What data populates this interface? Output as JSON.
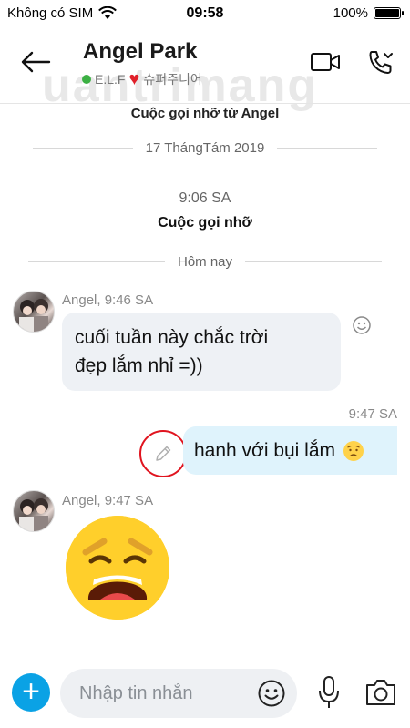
{
  "status": {
    "carrier": "Không có SIM",
    "time": "09:58",
    "battery": "100%"
  },
  "header": {
    "name": "Angel Park",
    "status_label": "E.L.F",
    "mood": "슈퍼주니어",
    "pinned": "Cuộc gọi nhỡ từ Angel"
  },
  "messages": {
    "date1": "17 ThángTám 2019",
    "call_time": "9:06 SA",
    "call_label": "Cuộc gọi nhỡ",
    "today": "Hôm nay",
    "msg1": {
      "sender": "Angel, 9:46 SA",
      "line1": "cuối tuần này chắc trời",
      "line2": "đẹp lắm nhỉ =))"
    },
    "msg2": {
      "time": "9:47 SA",
      "text": "hanh với bụi lắm"
    },
    "msg3": {
      "sender": "Angel, 9:47 SA"
    }
  },
  "composer": {
    "placeholder": "Nhập tin nhắn"
  },
  "watermark": "uantrimang",
  "colors": {
    "accent": "#0aa2e5",
    "bubble_out": "#dff3fc",
    "bubble_in": "#eef1f5",
    "highlight": "#e0141f"
  },
  "icons": [
    "back-arrow-icon",
    "video-call-icon",
    "phone-call-icon",
    "add-reaction-icon",
    "edit-pencil-icon",
    "plus-icon",
    "emoji-icon",
    "microphone-icon",
    "camera-icon"
  ]
}
